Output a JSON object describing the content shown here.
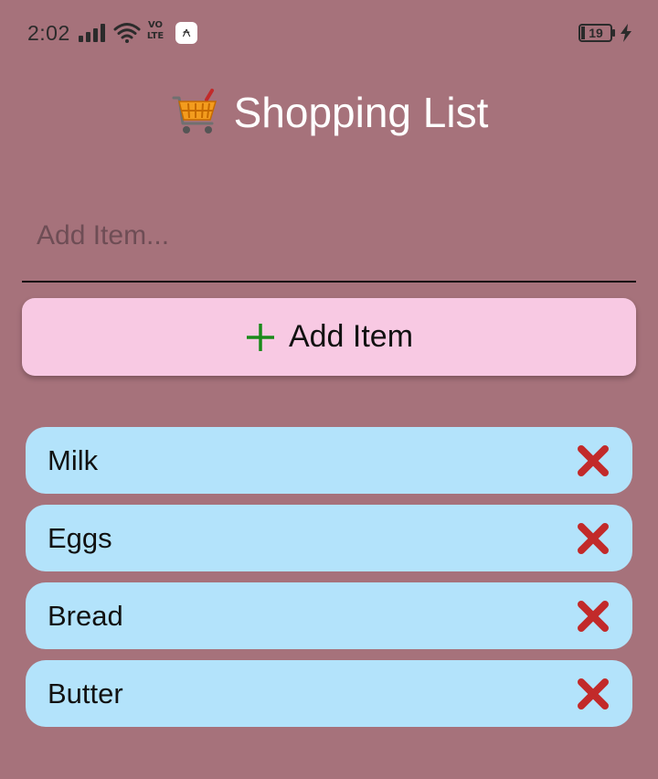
{
  "status_bar": {
    "time": "2:02",
    "network_label_top": "VO",
    "network_label_bottom": "LTE",
    "app_notification_glyph": "⍲",
    "battery_level": "19",
    "icons": [
      "signal-icon",
      "wifi-icon",
      "volte-icon",
      "app-notification-icon",
      "battery-icon",
      "charging-icon"
    ]
  },
  "header": {
    "title": "Shopping List",
    "icon": "shopping-cart-icon"
  },
  "input": {
    "placeholder": "Add Item...",
    "value": ""
  },
  "add_button": {
    "label": "Add Item",
    "icon": "plus-icon"
  },
  "items": [
    {
      "label": "Milk"
    },
    {
      "label": "Eggs"
    },
    {
      "label": "Bread"
    },
    {
      "label": "Butter"
    }
  ],
  "colors": {
    "background": "#a6727b",
    "button_bg": "#f8c9e3",
    "item_bg": "#b3e3fb",
    "delete_red": "#c22a2a",
    "plus_green": "#1a8a1a",
    "cart_orange": "#f39c1e"
  }
}
